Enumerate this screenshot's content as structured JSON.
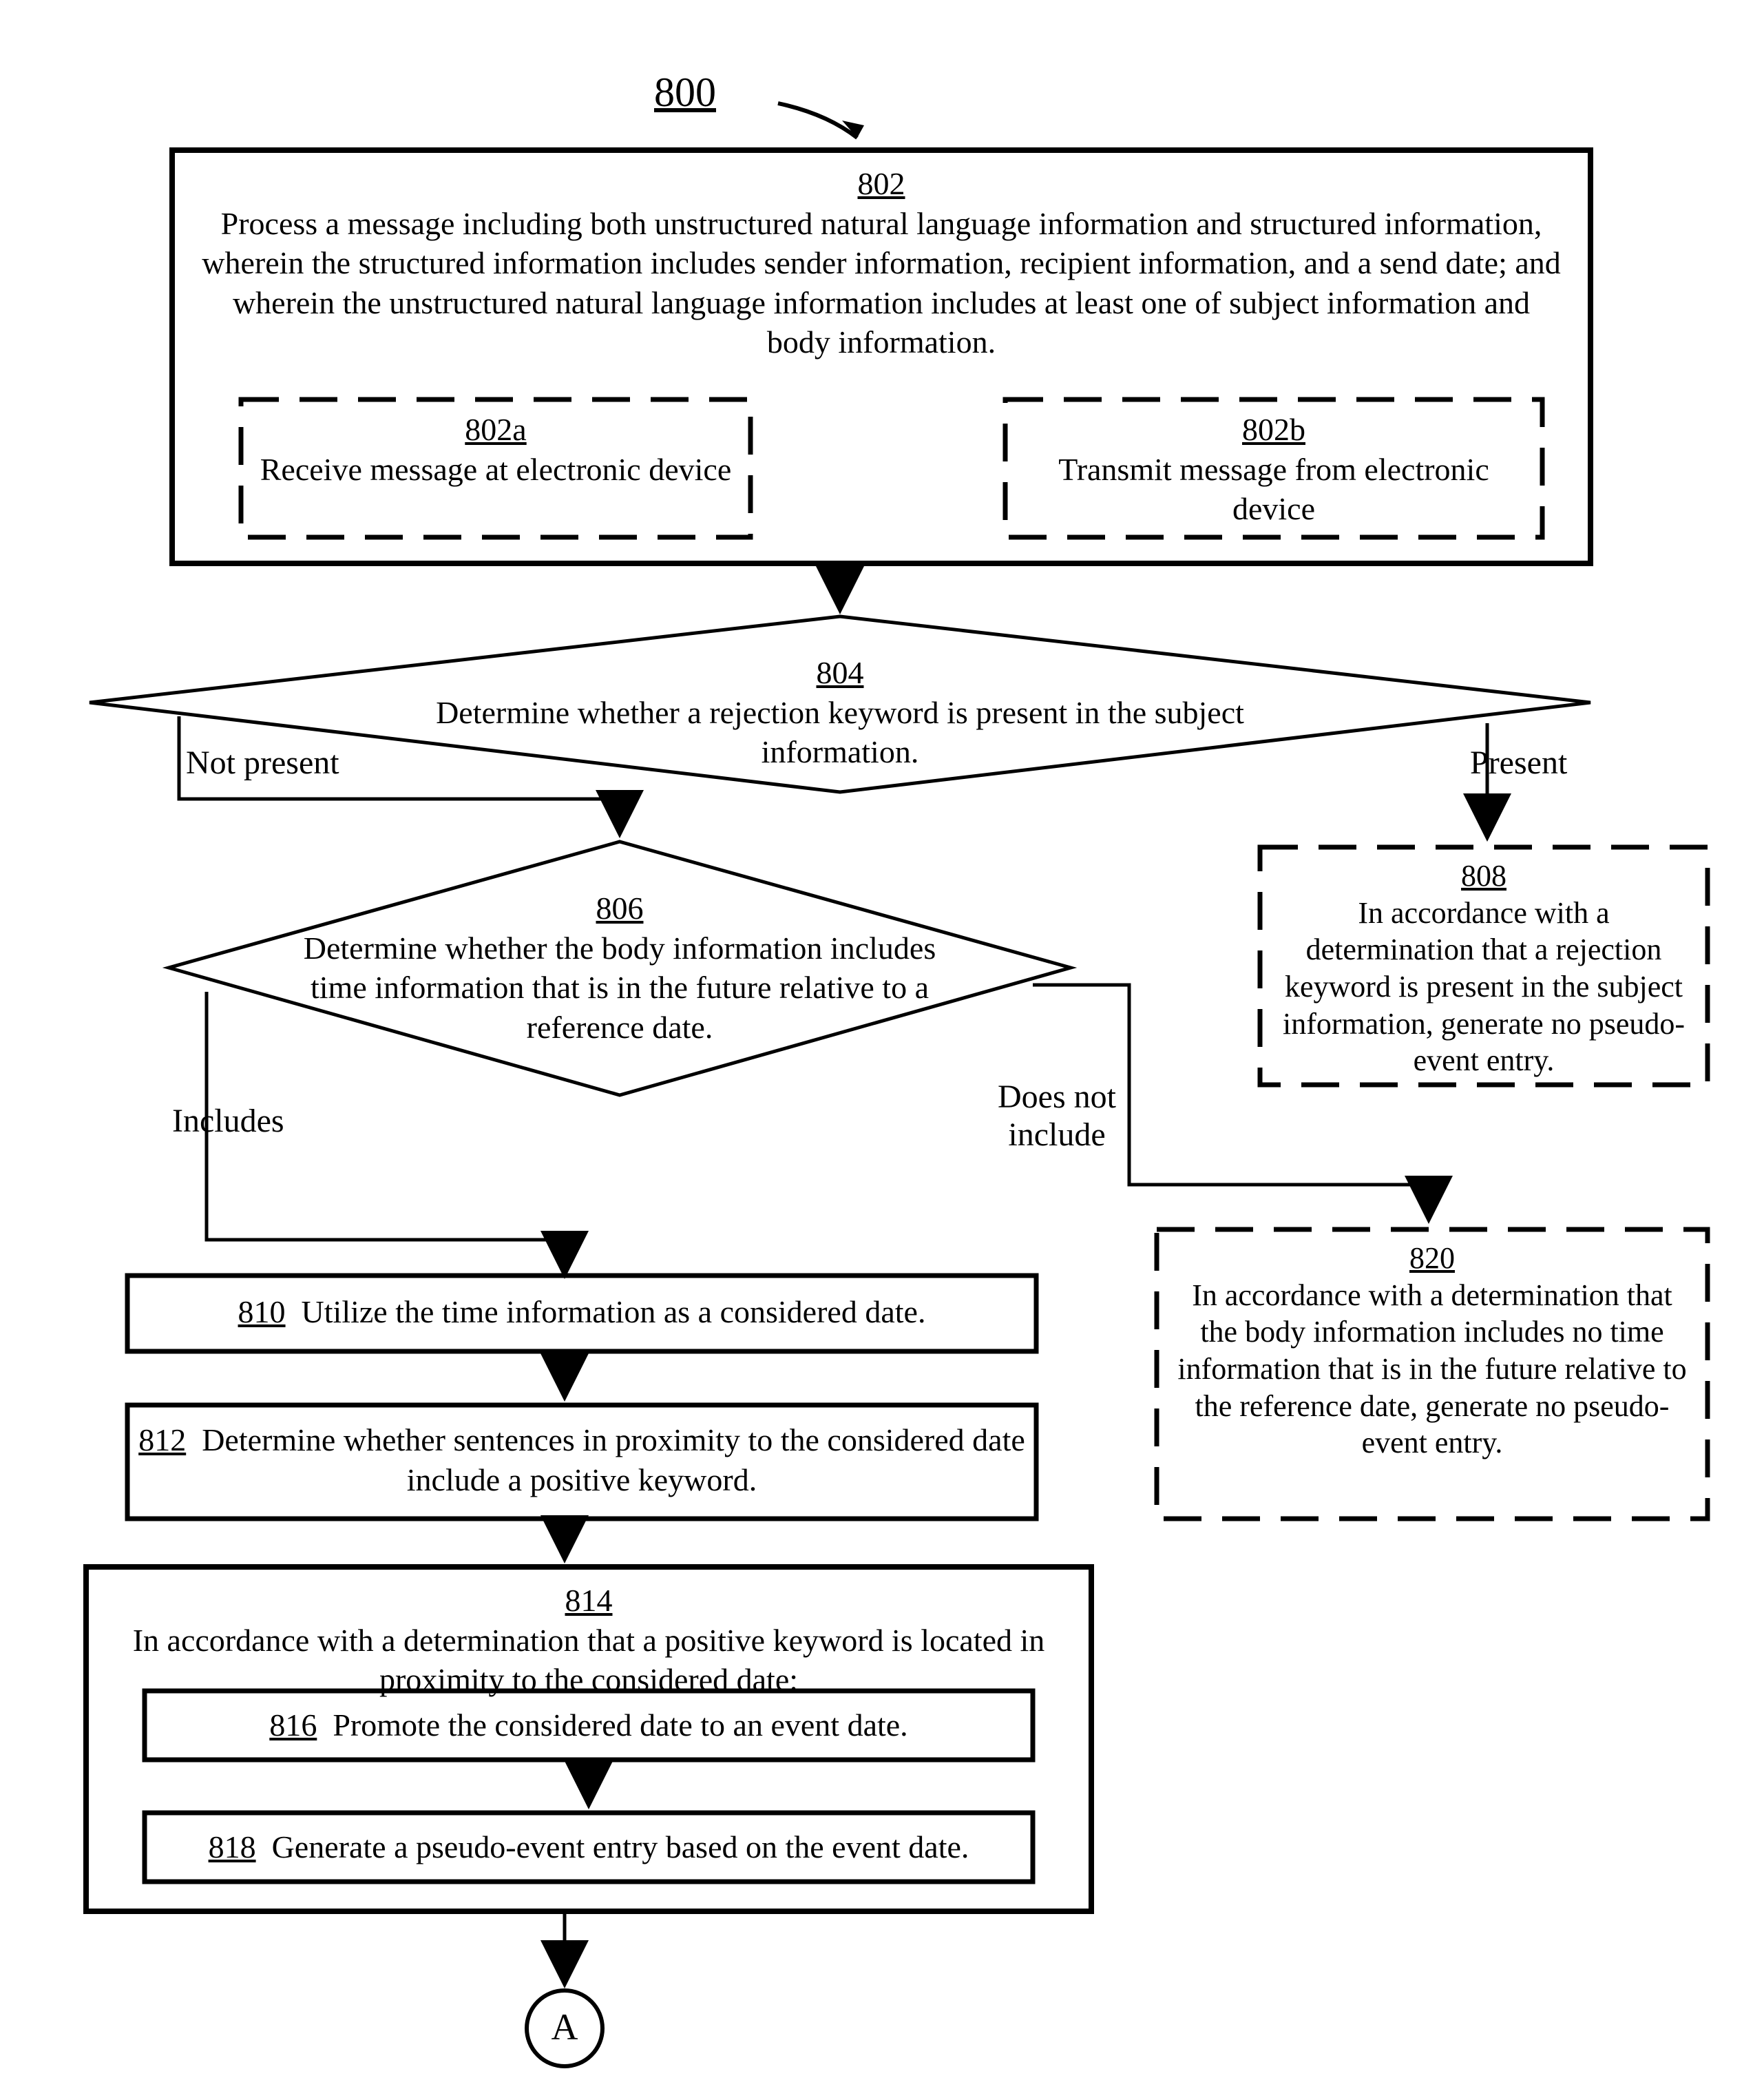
{
  "chart_data": {
    "type": "flowchart",
    "title_ref": "800",
    "nodes": [
      {
        "id": "802",
        "type": "process",
        "border": "solid",
        "text": "Process a message including both unstructured natural language information and structured information, wherein the structured information includes sender information, recipient information, and a send date; and wherein the unstructured natural language information includes at least one of subject information and body information.",
        "children": [
          {
            "id": "802a",
            "border": "dashed",
            "text": "Receive message at electronic device"
          },
          {
            "id": "802b",
            "border": "dashed",
            "text": "Transmit message from electronic device"
          }
        ]
      },
      {
        "id": "804",
        "type": "decision",
        "text": "Determine whether a rejection keyword is present in the subject information.",
        "branches": [
          {
            "label": "Not present",
            "to": "806"
          },
          {
            "label": "Present",
            "to": "808"
          }
        ]
      },
      {
        "id": "806",
        "type": "decision",
        "text": "Determine whether the body information includes time information that is in the future relative to a reference date.",
        "branches": [
          {
            "label": "Includes",
            "to": "810"
          },
          {
            "label": "Does not include",
            "to": "820"
          }
        ]
      },
      {
        "id": "808",
        "type": "process",
        "border": "dashed",
        "text": "In accordance with a determination that a rejection keyword is present in the subject information, generate no pseudo-event entry."
      },
      {
        "id": "820",
        "type": "process",
        "border": "dashed",
        "text": "In accordance with a determination that the body information includes no time information that is in the future relative to the reference date, generate no pseudo-event entry."
      },
      {
        "id": "810",
        "type": "process",
        "border": "solid",
        "text": "Utilize the time information as a considered date."
      },
      {
        "id": "812",
        "type": "process",
        "border": "solid",
        "text": "Determine whether sentences in proximity to the considered date include a positive keyword."
      },
      {
        "id": "814",
        "type": "process",
        "border": "solid",
        "text": "In accordance with a determination that a positive keyword is located in proximity to the considered date:",
        "children": [
          {
            "id": "816",
            "border": "solid",
            "text": "Promote the considered date to an event date."
          },
          {
            "id": "818",
            "border": "solid",
            "text": "Generate a pseudo-event entry based on the event date."
          }
        ]
      },
      {
        "id": "A",
        "type": "connector",
        "text": "A"
      }
    ],
    "edges": [
      {
        "from": "802",
        "to": "804"
      },
      {
        "from": "804",
        "to": "806",
        "label": "Not present"
      },
      {
        "from": "804",
        "to": "808",
        "label": "Present"
      },
      {
        "from": "806",
        "to": "810",
        "label": "Includes"
      },
      {
        "from": "806",
        "to": "820",
        "label": "Does not include"
      },
      {
        "from": "810",
        "to": "812"
      },
      {
        "from": "812",
        "to": "814"
      },
      {
        "from": "816",
        "to": "818"
      },
      {
        "from": "814",
        "to": "A"
      }
    ]
  },
  "title": {
    "ref": "800"
  },
  "box802": {
    "ref": "802",
    "text": "Process a message including both unstructured natural language information and structured information, wherein the structured information includes sender information, recipient information, and a send date; and wherein the unstructured natural language information includes at least one of subject information and body information."
  },
  "box802a": {
    "ref": "802a",
    "text": "Receive message at electronic device"
  },
  "box802b": {
    "ref": "802b",
    "text": "Transmit message from electronic device"
  },
  "dec804": {
    "ref": "804",
    "text": "Determine whether a rejection keyword is present in the subject information."
  },
  "dec804_left": "Not present",
  "dec804_right": "Present",
  "dec806": {
    "ref": "806",
    "text": "Determine whether the body information includes time information that is in the future relative to a reference date."
  },
  "dec806_left": "Includes",
  "dec806_right_l1": "Does not",
  "dec806_right_l2": "include",
  "box808": {
    "ref": "808",
    "text": "In accordance with a determination that a rejection keyword is present in the subject information, generate no pseudo-event entry."
  },
  "box820": {
    "ref": "820",
    "text": "In accordance with a determination that the body information includes no time information that is in the future relative to the reference date, generate no pseudo-event entry."
  },
  "box810": {
    "ref": "810",
    "text": "Utilize the time information as a considered date."
  },
  "box812": {
    "ref": "812",
    "text": "Determine whether sentences in proximity to the considered date include a positive keyword."
  },
  "box814": {
    "ref": "814",
    "text": "In accordance with a determination that a positive keyword is located in proximity to the considered date:"
  },
  "box816": {
    "ref": "816",
    "text": "Promote the considered date to an event date."
  },
  "box818": {
    "ref": "818",
    "text": "Generate a pseudo-event entry based on the event date."
  },
  "connA": {
    "text": "A"
  }
}
